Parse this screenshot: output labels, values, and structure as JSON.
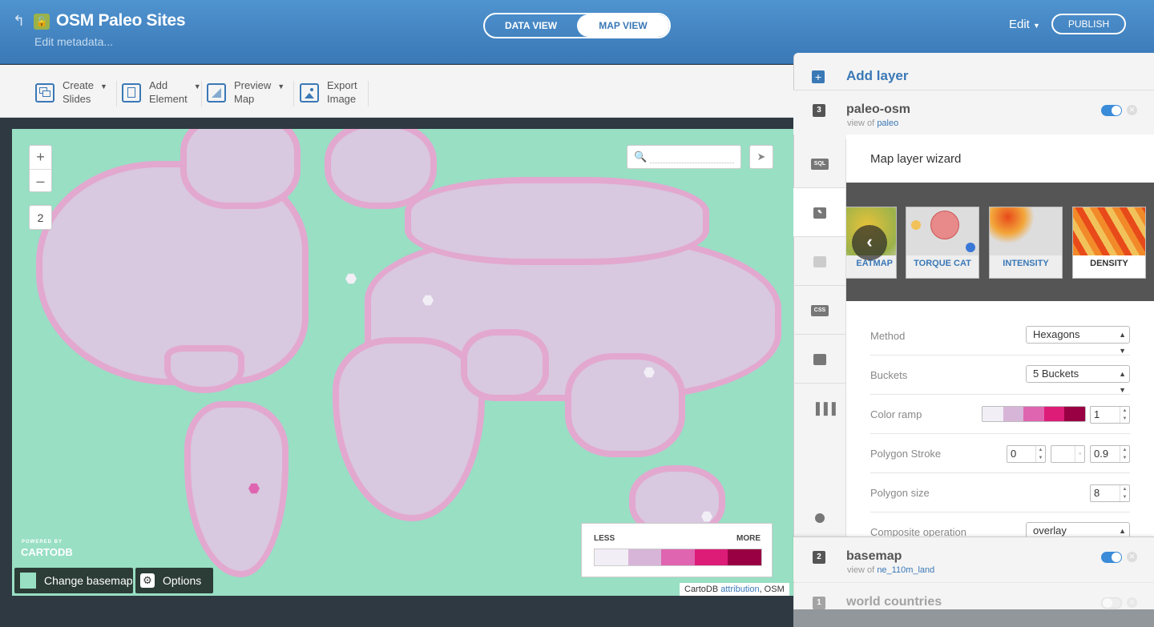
{
  "header": {
    "title": "OSM Paleo Sites",
    "metadata_link": "Edit metadata...",
    "view_tabs": [
      "DATA VIEW",
      "MAP VIEW"
    ],
    "active_view": "MAP VIEW",
    "edit_label": "Edit",
    "publish_label": "PUBLISH"
  },
  "toolbar": {
    "items": [
      {
        "line1": "Create",
        "line2": "Slides"
      },
      {
        "line1": "Add",
        "line2": "Element"
      },
      {
        "line1": "Preview",
        "line2": "Map"
      },
      {
        "line1": "Export",
        "line2": "Image"
      }
    ]
  },
  "map": {
    "zoom_in": "+",
    "zoom_out": "–",
    "slide_number": "2",
    "search_placeholder": "",
    "legend": {
      "less": "LESS",
      "more": "MORE",
      "colors": [
        "#f2eef5",
        "#d7b5d8",
        "#df65b0",
        "#dd1c77",
        "#980043"
      ]
    },
    "powered_by": "POWERED BY",
    "brand": "CARTODB",
    "change_basemap": "Change basemap",
    "options": "Options",
    "attribution_prefix": "CartoDB",
    "attribution_link": "attribution",
    "attribution_suffix": ", OSM"
  },
  "panel": {
    "add_layer": "Add layer",
    "layers": [
      {
        "number": "3",
        "name": "paleo-osm",
        "view_of": "view of",
        "source": "paleo",
        "visible": true
      },
      {
        "number": "2",
        "name": "basemap",
        "view_of": "view of",
        "source": "ne_110m_land",
        "visible": true
      },
      {
        "number": "1",
        "name": "world countries",
        "view_of": "",
        "source": "",
        "visible": false
      }
    ],
    "side_tabs": [
      "SQL",
      "wizard",
      "infowindow",
      "CSS",
      "legends",
      "filters",
      "help"
    ],
    "wizard": {
      "title": "Map layer wizard",
      "types": [
        "EATMAP",
        "TORQUE CAT",
        "INTENSITY",
        "DENSITY"
      ],
      "selected_type": "DENSITY",
      "method_label": "Method",
      "method_value": "Hexagons",
      "buckets_label": "Buckets",
      "buckets_value": "5 Buckets",
      "color_ramp_label": "Color ramp",
      "color_ramp": [
        "#f2eef5",
        "#d7b5d8",
        "#df65b0",
        "#dd1c77",
        "#980043"
      ],
      "color_ramp_opacity": "1",
      "polygon_stroke_label": "Polygon Stroke",
      "polygon_stroke_width": "0",
      "polygon_stroke_opacity": "0.9",
      "polygon_size_label": "Polygon size",
      "polygon_size_value": "8",
      "composite_label": "Composite operation",
      "composite_value": "overlay"
    }
  }
}
